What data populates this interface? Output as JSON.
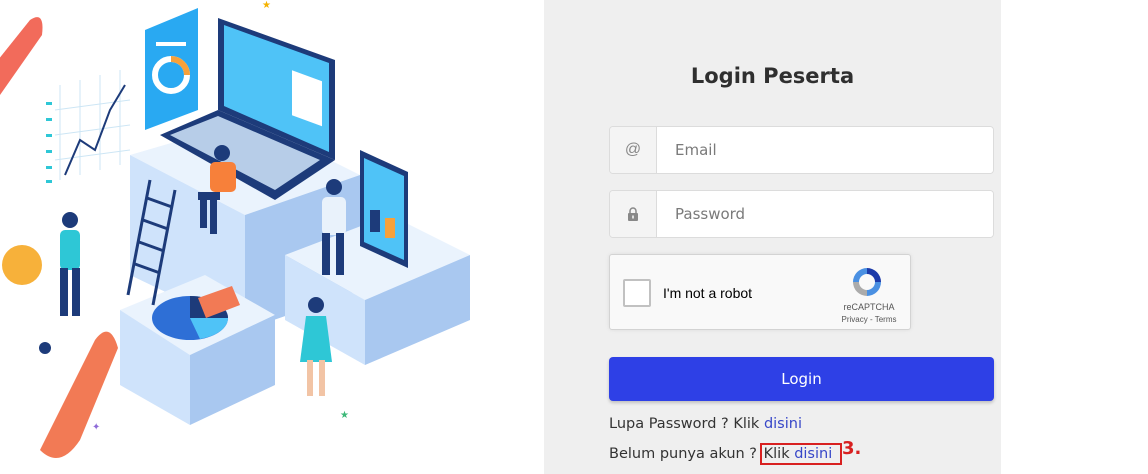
{
  "login": {
    "title": "Login Peserta",
    "email_icon": "@",
    "email_placeholder": "Email",
    "password_icon": "lock-icon",
    "password_placeholder": "Password",
    "button_label": "Login"
  },
  "recaptcha": {
    "label": "I'm not a robot",
    "brand": "reCAPTCHA",
    "terms": "Privacy - Terms"
  },
  "links": {
    "forgot_prefix": "Lupa Password ? Klik ",
    "forgot_link": "disini",
    "register_prefix": "Belum punya akun ? ",
    "register_klik": "Klik ",
    "register_link": "disini"
  },
  "annotation": {
    "marker": "3."
  },
  "colors": {
    "primary": "#2e40e6",
    "link": "#3747c8",
    "annotation": "#d82020",
    "panel_bg": "#efefef"
  }
}
